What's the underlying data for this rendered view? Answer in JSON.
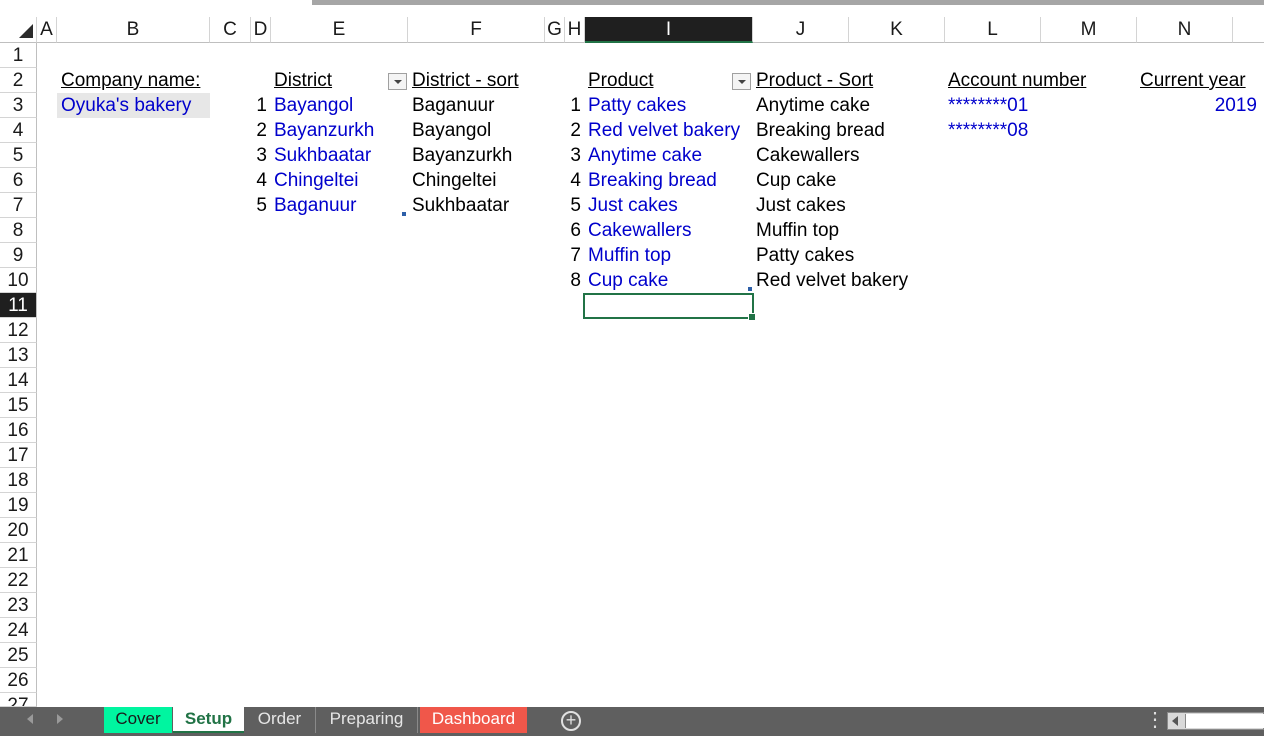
{
  "columns": [
    "A",
    "B",
    "C",
    "D",
    "E",
    "F",
    "G",
    "H",
    "I",
    "J",
    "K",
    "L",
    "M",
    "N"
  ],
  "rows": [
    "1",
    "2",
    "3",
    "4",
    "5",
    "6",
    "7",
    "8",
    "9",
    "10",
    "11",
    "12",
    "13",
    "14",
    "15",
    "16",
    "17",
    "18",
    "19",
    "20",
    "21",
    "22",
    "23",
    "24",
    "25",
    "26",
    "27"
  ],
  "selected_column": "I",
  "selected_row": "11",
  "company": {
    "label": "Company name:",
    "value": "Oyuka's bakery"
  },
  "district": {
    "header": "District",
    "numbers": [
      "1",
      "2",
      "3",
      "4",
      "5"
    ],
    "items": [
      "Bayangol",
      "Bayanzurkh",
      "Sukhbaatar",
      "Chingeltei",
      "Baganuur"
    ],
    "sort_header": "District - sort",
    "sorted": [
      "Baganuur",
      "Bayangol",
      "Bayanzurkh",
      "Chingeltei",
      "Sukhbaatar"
    ]
  },
  "product": {
    "header": "Product",
    "numbers": [
      "1",
      "2",
      "3",
      "4",
      "5",
      "6",
      "7",
      "8"
    ],
    "items": [
      "Patty cakes",
      "Red velvet bakery",
      "Anytime cake",
      "Breaking bread",
      "Just cakes",
      "Cakewallers",
      "Muffin top",
      "Cup cake"
    ],
    "sort_header": "Product - Sort",
    "sorted": [
      "Anytime cake",
      "Breaking bread",
      "Cakewallers",
      "Cup cake",
      "Just cakes",
      "Muffin top",
      "Patty cakes",
      "Red velvet bakery"
    ]
  },
  "account": {
    "header": "Account number",
    "values": [
      "********01",
      "********08"
    ]
  },
  "year": {
    "header": "Current year",
    "value": "2019"
  },
  "sheet_tabs": [
    {
      "label": "Cover",
      "color": "#00f5a0",
      "text_color": "#1a1a1a"
    },
    {
      "label": "Setup",
      "active": true
    },
    {
      "label": "Order"
    },
    {
      "label": "Preparing"
    },
    {
      "label": "Dashboard",
      "color": "#f0574a",
      "text_color": "#ffffff"
    }
  ],
  "colors": {
    "input_blue": "#0000cc",
    "selection_green": "#217346"
  }
}
